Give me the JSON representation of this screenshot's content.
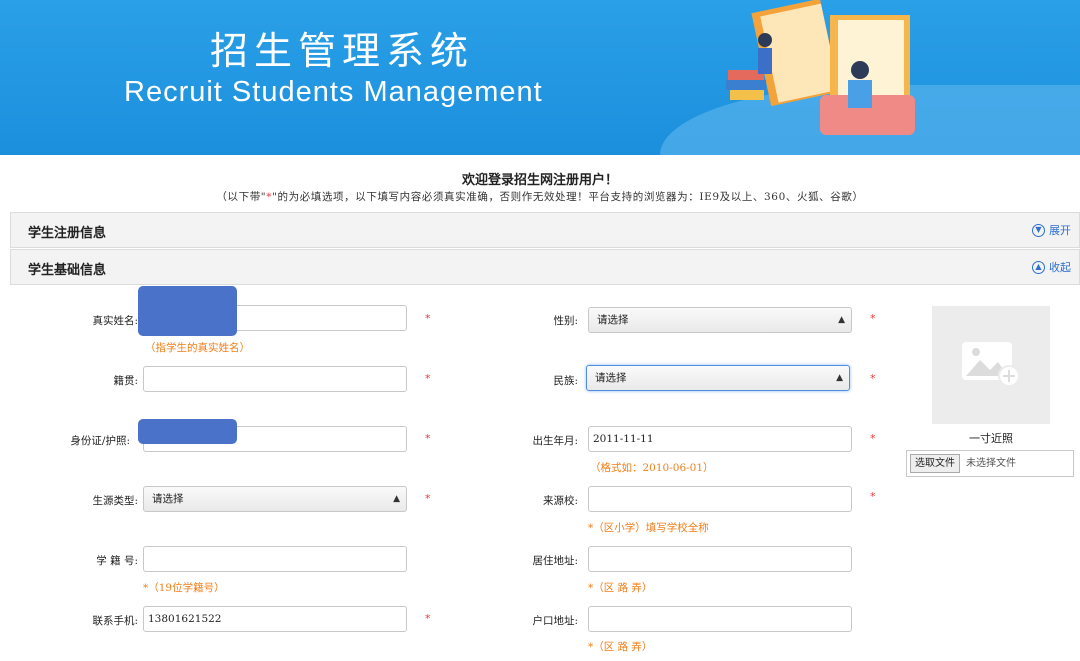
{
  "header": {
    "title_cn": "招生管理系统",
    "title_en": "Recruit Students  Management"
  },
  "welcome": {
    "title": "欢迎登录招生网注册用户！",
    "note_prefix": "（以下带\"",
    "note_star": "*",
    "note_suffix": "\"的为必填选项，以下填写内容必须真实准确，否则作无效处理！平台支持的浏览器为：IE9及以上、360、火狐、谷歌）"
  },
  "sections": {
    "register": {
      "label": "学生注册信息",
      "toggle": "展开",
      "icon": "chevron-down-icon"
    },
    "basic": {
      "label": "学生基础信息",
      "toggle": "收起",
      "icon": "chevron-up-icon"
    }
  },
  "form": {
    "real_name": {
      "label": "真实姓名:",
      "value": "",
      "hint": "（指学生的真实姓名）"
    },
    "gender": {
      "label": "性别:",
      "value": "请选择"
    },
    "native_place": {
      "label": "籍贯:",
      "value": ""
    },
    "ethnicity": {
      "label": "民族:",
      "value": "请选择"
    },
    "id_card": {
      "label": "身份证/护照:",
      "value": ""
    },
    "birth_date": {
      "label": "出生年月:",
      "value": "2011-11-11",
      "hint": "（格式如：2010-06-01）"
    },
    "source_type": {
      "label": "生源类型:",
      "value": "请选择"
    },
    "source_school": {
      "label": "来源校:",
      "value": "",
      "hint": "*（区小学）填写学校全称"
    },
    "student_no": {
      "label": "学 籍 号:",
      "value": "",
      "hint": "*（19位学籍号）"
    },
    "home_address": {
      "label": "居住地址:",
      "value": "",
      "hint": "*（区 路 弄）"
    },
    "phone": {
      "label": "联系手机:",
      "value": "13801621522"
    },
    "hukou_address": {
      "label": "户口地址:",
      "value": "",
      "hint": "*（区 路 弄）"
    },
    "required_mark": "*"
  },
  "photo": {
    "caption": "一寸近照",
    "choose_file": "选取文件",
    "no_file": "未选择文件",
    "icon": "image-add-icon"
  },
  "colors": {
    "banner": "#1c8fdc",
    "required": "#e53b3b",
    "hint": "#f07f1a",
    "link": "#2d6fd0"
  }
}
